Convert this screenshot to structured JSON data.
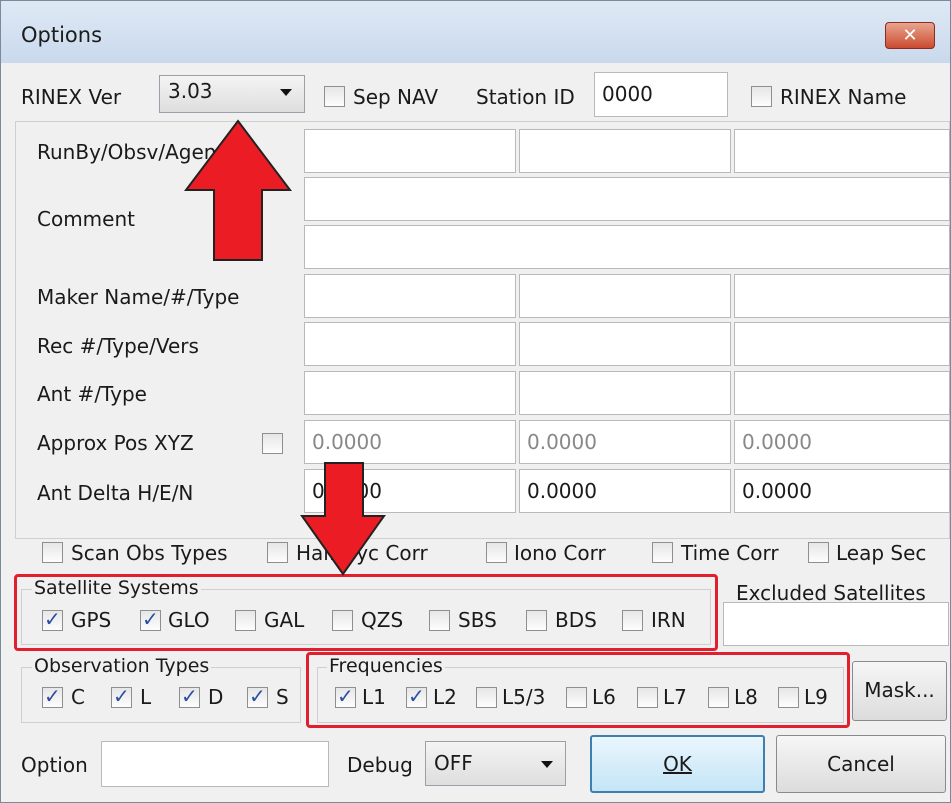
{
  "window": {
    "title": "Options"
  },
  "top": {
    "rinex_ver_label": "RINEX Ver",
    "rinex_ver_value": "3.03",
    "sep_nav_label": "Sep NAV",
    "station_id_label": "Station ID",
    "station_id_value": "0000",
    "rinex_name_label": "RINEX Name"
  },
  "header_fields": {
    "runby_label": "RunBy/Obsv/Agency",
    "comment_label": "Comment",
    "maker_label": "Maker Name/#/Type",
    "rec_label": "Rec #/Type/Vers",
    "ant_label": "Ant #/Type",
    "approx_pos_label": "Approx Pos XYZ",
    "approx_pos_values": [
      "0.0000",
      "0.0000",
      "0.0000"
    ],
    "ant_delta_label": "Ant Delta H/E/N",
    "ant_delta_values": [
      "0.0000",
      "0.0000",
      "0.0000"
    ]
  },
  "correction_options": {
    "scan_obs": "Scan Obs Types",
    "half_cyc": "Half Cyc Corr",
    "iono": "Iono Corr",
    "time": "Time Corr",
    "leap": "Leap Sec"
  },
  "satellite_systems": {
    "label": "Satellite Systems",
    "items": [
      {
        "label": "GPS",
        "checked": true
      },
      {
        "label": "GLO",
        "checked": true
      },
      {
        "label": "GAL",
        "checked": false
      },
      {
        "label": "QZS",
        "checked": false
      },
      {
        "label": "SBS",
        "checked": false
      },
      {
        "label": "BDS",
        "checked": false
      },
      {
        "label": "IRN",
        "checked": false
      }
    ]
  },
  "excluded_satellites": {
    "label": "Excluded Satellites",
    "value": ""
  },
  "observation_types": {
    "label": "Observation Types",
    "items": [
      {
        "label": "C",
        "checked": true
      },
      {
        "label": "L",
        "checked": true
      },
      {
        "label": "D",
        "checked": true
      },
      {
        "label": "S",
        "checked": true
      }
    ]
  },
  "frequencies": {
    "label": "Frequencies",
    "items": [
      {
        "label": "L1",
        "checked": true
      },
      {
        "label": "L2",
        "checked": true
      },
      {
        "label": "L5/3",
        "checked": false
      },
      {
        "label": "L6",
        "checked": false
      },
      {
        "label": "L7",
        "checked": false
      },
      {
        "label": "L8",
        "checked": false
      },
      {
        "label": "L9",
        "checked": false
      }
    ]
  },
  "bottom": {
    "mask_button": "Mask...",
    "option_label": "Option",
    "option_value": "",
    "debug_label": "Debug",
    "debug_value": "OFF",
    "ok_button": "OK",
    "cancel_button": "Cancel"
  },
  "colors": {
    "highlight": "#e0202e",
    "titlebar": "#c9d9ec",
    "dialog_bg": "#f0f0f0"
  }
}
